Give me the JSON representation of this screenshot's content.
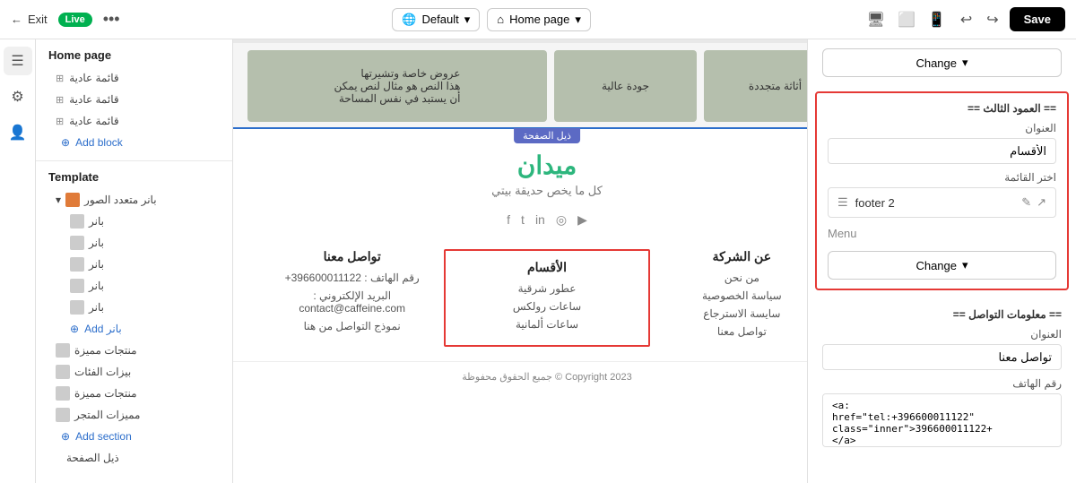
{
  "topbar": {
    "exit_label": "Exit",
    "live_label": "Live",
    "more_icon": "•••",
    "default_label": "Default",
    "homepage_label": "Home page",
    "undo_icon": "↩",
    "redo_icon": "↪",
    "save_label": "Save"
  },
  "left_sidebar": {
    "icons": [
      "☰",
      "⚙",
      "👤"
    ]
  },
  "nav": {
    "section_title": "Home page",
    "items": [
      {
        "label": "قائمة عادية",
        "icon": "⊞"
      },
      {
        "label": "قائمة عادية",
        "icon": "⊞"
      },
      {
        "label": "قائمة عادية",
        "icon": "⊞"
      }
    ],
    "add_block_label": "Add block",
    "template_label": "Template",
    "tree": [
      {
        "label": "بانر متعدد الصور",
        "type": "parent",
        "colored": true
      },
      {
        "label": "بانر",
        "type": "child"
      },
      {
        "label": "بانر",
        "type": "child"
      },
      {
        "label": "بانر",
        "type": "child"
      },
      {
        "label": "بانر",
        "type": "child"
      },
      {
        "label": "بانر",
        "type": "child"
      }
    ],
    "add_banner_label": "Add  بانر",
    "sections": [
      {
        "label": "منتجات مميزة",
        "icon": "⊞"
      },
      {
        "label": "بيزات الفئات",
        "icon": "⊞"
      },
      {
        "label": "منتجات مميزة",
        "icon": "⊞"
      },
      {
        "label": "مميزات المتجر",
        "icon": "⊞"
      }
    ],
    "add_section_label": "Add section",
    "footer_label": "ذيل الصفحة",
    "footer_icon": "⊞"
  },
  "canvas": {
    "page_indicator": "ذيل الصفحة",
    "brand_name": "ميدان",
    "brand_subtitle": "كل ما يخص حديقة بيتي",
    "social_icons": [
      "f",
      "t",
      "in",
      "◎",
      "▶"
    ],
    "footer_cols": [
      {
        "title": "عن الشركة",
        "items": [
          "من نحن",
          "سياسة الخصوصية",
          "سايسة الاسترجاع",
          "تواصل معنا"
        ]
      },
      {
        "title": "الأقسام",
        "items": [
          "عطور شرقية",
          "ساعات رولكس",
          "ساعات ألمانية"
        ]
      },
      {
        "title": "تواصل معنا",
        "items": [
          "رقم الهاتف : 396600011122+",
          "البريد الإلكتروني : contact@caffeine.com",
          "نموذج التواصل من هنا"
        ]
      }
    ],
    "copyright": "Copyright 2023 © جميع الحقوق محفوظة",
    "hero_cards": [
      {
        "text": "عروض خاصة وتشيرنه\nهذا النص هو مثال لنص يمكن\nأن يستبد في نفس المساحة"
      },
      {
        "text": "جودة عالية"
      },
      {
        "text": "أثاثة متجددة"
      }
    ]
  },
  "right_panel": {
    "change_label_1": "Change",
    "section_third_col_title": "== العمود الثالث ==",
    "field_title_label": "العنوان",
    "field_title_value": "الأقسام",
    "field_list_label": "اختر القائمة",
    "menu_item_label": "footer 2",
    "menu_sub_label": "Menu",
    "change_label_2": "Change",
    "section_contact_title": "== معلومات التواصل ==",
    "contact_title_label": "العنوان",
    "contact_title_value": "تواصل معنا",
    "phone_label": "رقم الهاتف",
    "phone_value": "<a:\nhref=\"tel:+396600011122\"\nclass=\"inner\">396600011122+\n</a>"
  }
}
